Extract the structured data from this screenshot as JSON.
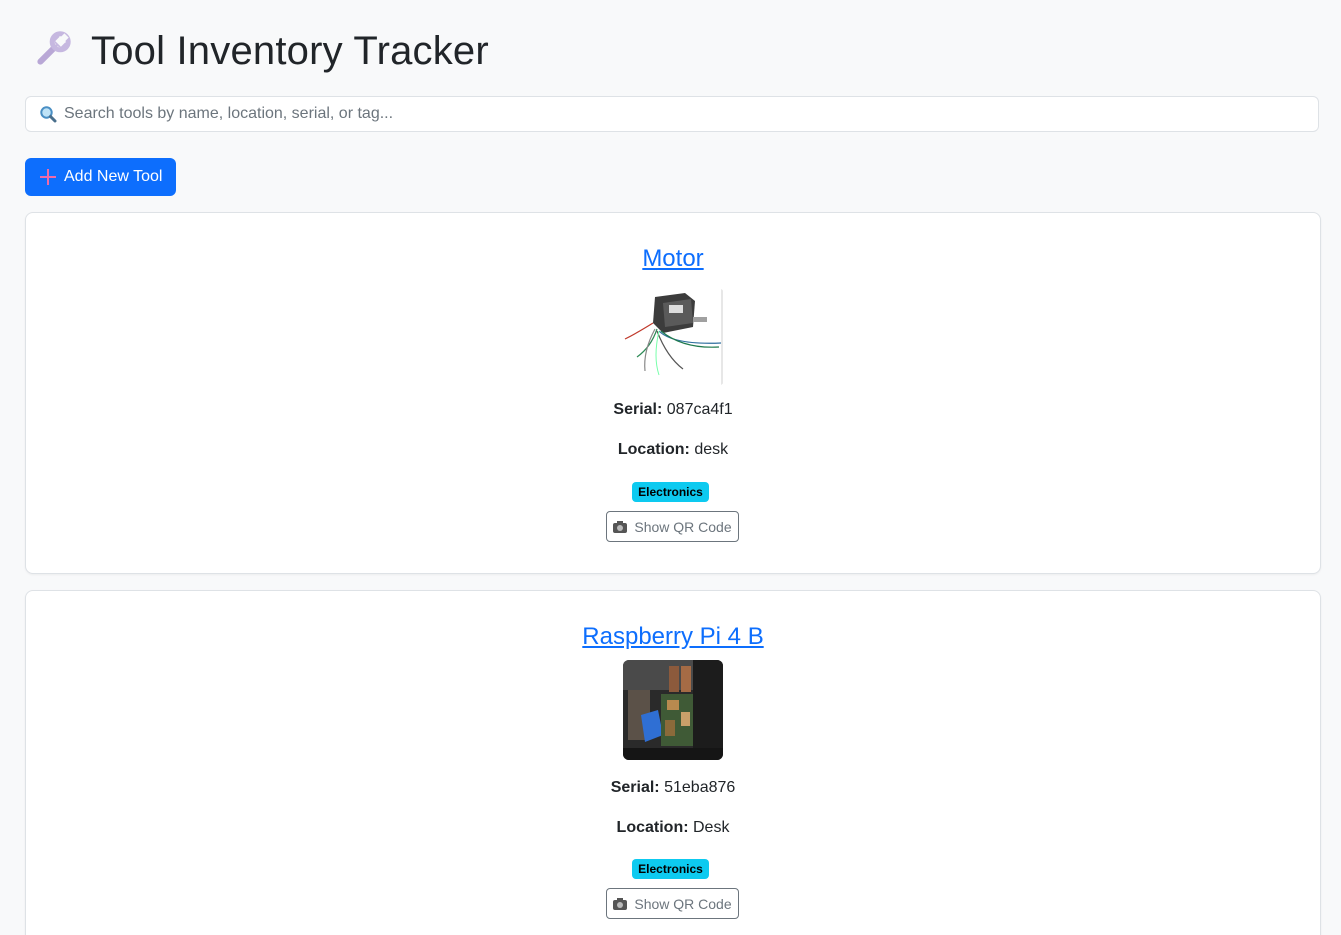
{
  "header": {
    "title": "Tool Inventory Tracker",
    "icon": "wrench-icon"
  },
  "search": {
    "placeholder": "Search tools by name, location, serial, or tag...",
    "value": "",
    "icon": "search-icon"
  },
  "toolbar": {
    "add_label": "Add New Tool",
    "add_icon": "plus-icon"
  },
  "tools": [
    {
      "name": "Motor",
      "serial_label": "Serial:",
      "serial": "087ca4f1",
      "location_label": "Location:",
      "location": "desk",
      "tag": "Electronics",
      "qr_label": "Show QR Code",
      "image": "motor-photo"
    },
    {
      "name": "Raspberry Pi 4 B",
      "serial_label": "Serial:",
      "serial": "51eba876",
      "location_label": "Location:",
      "location": "Desk",
      "tag": "Electronics",
      "qr_label": "Show QR Code",
      "image": "raspberry-pi-photo"
    }
  ],
  "colors": {
    "primary": "#0d6efd",
    "tag_bg": "#0dcaf0",
    "page_bg": "#f8f9fa"
  }
}
